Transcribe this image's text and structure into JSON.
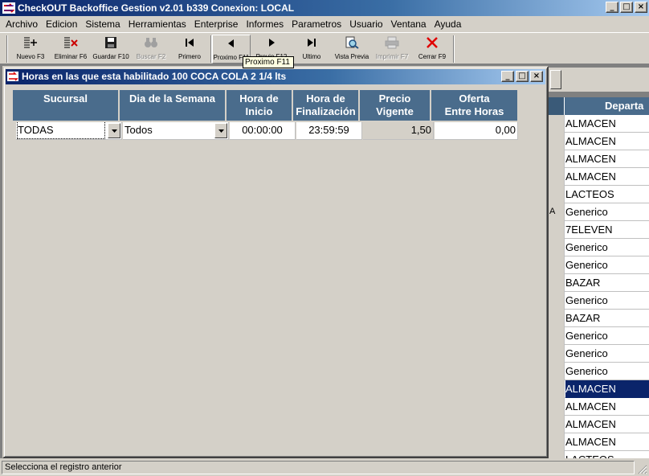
{
  "app": {
    "title": "CheckOUT Backoffice Gestion v2.01 b339 Conexion: LOCAL",
    "window_buttons": [
      "_",
      "□",
      "×"
    ]
  },
  "menu": [
    "Archivo",
    "Edicion",
    "Sistema",
    "Herramientas",
    "Enterprise",
    "Informes",
    "Parametros",
    "Usuario",
    "Ventana",
    "Ayuda"
  ],
  "toolbar": {
    "nuevo": "Nuevo F3",
    "eliminar": "Eliminar F6",
    "guardar": "Guardar F10",
    "buscar": "Buscar F2",
    "primero": "Primero",
    "proximo": "Proximo F11",
    "previo": "Previo F12",
    "ultimo": "Ultimo",
    "vista_previa": "Vista Previa",
    "imprimir": "Imprimir F7",
    "cerrar": "Cerrar F9"
  },
  "tooltip": "Proximo F11",
  "background_grid": {
    "header": "Departa",
    "rows": [
      {
        "lead": "",
        "value": "ALMACEN"
      },
      {
        "lead": "",
        "value": "ALMACEN"
      },
      {
        "lead": "",
        "value": "ALMACEN"
      },
      {
        "lead": "",
        "value": "ALMACEN"
      },
      {
        "lead": "",
        "value": "LACTEOS"
      },
      {
        "lead": "A",
        "value": "Generico"
      },
      {
        "lead": "",
        "value": "7ELEVEN"
      },
      {
        "lead": "",
        "value": "Generico"
      },
      {
        "lead": "",
        "value": "Generico"
      },
      {
        "lead": "",
        "value": "BAZAR"
      },
      {
        "lead": "",
        "value": "Generico"
      },
      {
        "lead": "",
        "value": "BAZAR"
      },
      {
        "lead": "",
        "value": "Generico"
      },
      {
        "lead": "",
        "value": "Generico"
      },
      {
        "lead": "",
        "value": "Generico"
      },
      {
        "lead": "",
        "value": "ALMACEN"
      },
      {
        "lead": "",
        "value": "ALMACEN"
      },
      {
        "lead": "",
        "value": "ALMACEN"
      },
      {
        "lead": "",
        "value": "ALMACEN"
      },
      {
        "lead": "",
        "value": "LACTEOS"
      }
    ],
    "selected_index": 15
  },
  "child_window": {
    "title": "Horas en las que esta habilitado 100 COCA COLA 2 1/4 lts",
    "columns": [
      {
        "line1": "Sucursal",
        "line2": ""
      },
      {
        "line1": "Dia de la Semana",
        "line2": ""
      },
      {
        "line1": "Hora de",
        "line2": "Inicio"
      },
      {
        "line1": "Hora de",
        "line2": "Finalización"
      },
      {
        "line1": "Precio",
        "line2": "Vigente"
      },
      {
        "line1": "Oferta",
        "line2": "Entre Horas"
      }
    ],
    "row": {
      "sucursal": "TODAS",
      "dia": "Todos",
      "hora_inicio": "00:00:00",
      "hora_fin": "23:59:59",
      "precio": "1,50",
      "oferta": "0,00"
    }
  },
  "status": "Selecciona el registro anterior",
  "colors": {
    "title_gradient_start": "#0a246a",
    "header_bg": "#4a6c8c",
    "selection": "#0a246a",
    "face": "#d4d0c8"
  }
}
